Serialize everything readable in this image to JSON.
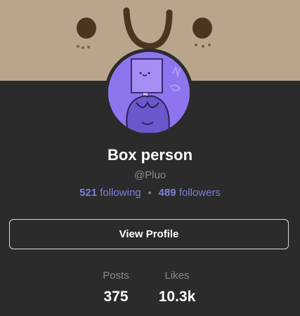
{
  "profile": {
    "display_name": "Box person",
    "handle": "@Pluo",
    "following_count": "521",
    "following_label": "following",
    "separator": "•",
    "followers_count": "489",
    "followers_label": "followers",
    "view_profile_label": "View Profile"
  },
  "stats": {
    "posts_label": "Posts",
    "posts_value": "375",
    "likes_label": "Likes",
    "likes_value": "10.3k"
  },
  "colors": {
    "card_background": "#2b2b2b",
    "banner": "#b8a58c",
    "avatar_background": "#8e74ee",
    "accent": "#7b7fd8",
    "muted_text": "#8a8a8a"
  },
  "icons": {
    "avatar": "box-person-avatar-image",
    "banner": "cartoon-face-banner-image"
  }
}
